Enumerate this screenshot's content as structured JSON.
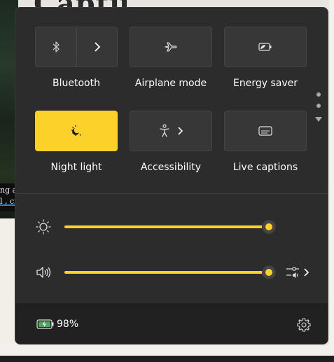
{
  "background": {
    "title_fragment": "Captu",
    "caption_lines": [
      "ng a",
      "l , cir"
    ]
  },
  "quick_settings": {
    "tiles": [
      {
        "id": "bluetooth",
        "label": "Bluetooth",
        "icon": "bluetooth-icon",
        "active": false,
        "has_expand": true
      },
      {
        "id": "airplane",
        "label": "Airplane mode",
        "icon": "airplane-icon",
        "active": false,
        "has_expand": false
      },
      {
        "id": "energy-saver",
        "label": "Energy saver",
        "icon": "energy-saver-icon",
        "active": false,
        "has_expand": false
      },
      {
        "id": "night-light",
        "label": "Night light",
        "icon": "night-light-icon",
        "active": true,
        "has_expand": false
      },
      {
        "id": "accessibility",
        "label": "Accessibility",
        "icon": "accessibility-icon",
        "active": false,
        "has_expand": true
      },
      {
        "id": "live-captions",
        "label": "Live captions",
        "icon": "live-captions-icon",
        "active": false,
        "has_expand": false
      }
    ],
    "pagination": {
      "dots": 2
    }
  },
  "sliders": {
    "brightness": {
      "icon": "brightness-icon",
      "value_percent": 100
    },
    "volume": {
      "icon": "volume-icon",
      "value_percent": 100,
      "extra_icon": "audio-output-icon"
    }
  },
  "footer": {
    "battery_percent": "98%",
    "battery_icon": "battery-charging-icon",
    "settings_icon": "gear-icon"
  },
  "colors": {
    "accent": "#fcd12a",
    "panel": "#2c2c2c",
    "tile": "#373737",
    "footer": "#212121"
  }
}
